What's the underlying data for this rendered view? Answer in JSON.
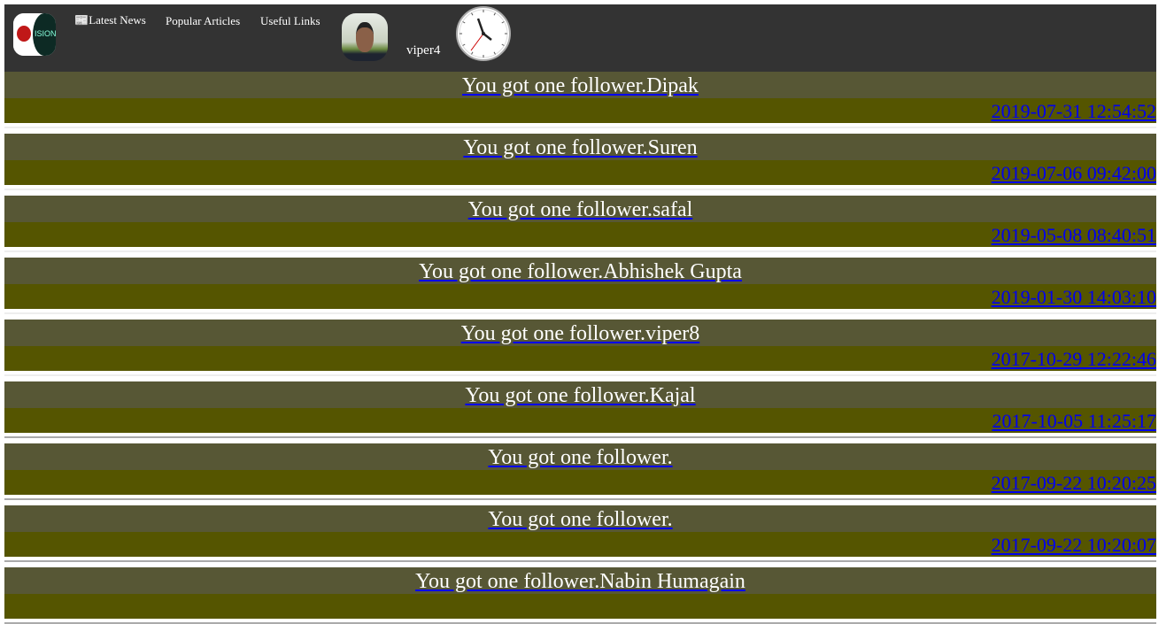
{
  "header": {
    "logo_text": "VISION",
    "nav": [
      {
        "label": "Latest News",
        "icon": "newspaper-icon"
      },
      {
        "label": "Popular Articles"
      },
      {
        "label": "Useful Links"
      }
    ],
    "username": "viper4",
    "clock": {
      "hour": 1,
      "minute": 54
    }
  },
  "notifications": [
    {
      "text": "You got one follower.Dipak",
      "date": "2019-07-31 12:54:52"
    },
    {
      "text": "You got one follower.Suren",
      "date": "2019-07-06 09:42:00"
    },
    {
      "text": "You got one follower.safal",
      "date": "2019-05-08 08:40:51"
    },
    {
      "text": "You got one follower.Abhishek Gupta",
      "date": "2019-01-30 14:03:10"
    },
    {
      "text": "You got one follower.viper8",
      "date": "2017-10-29 12:22:46"
    },
    {
      "text": "You got one follower.Kajal",
      "date": "2017-10-05 11:25:17"
    },
    {
      "text": "You got one follower.",
      "date": "2017-09-22 10:20:25"
    },
    {
      "text": "You got one follower.",
      "date": "2017-09-22 10:20:07"
    },
    {
      "text": "You got one follower.Nabin Humagain",
      "date": ""
    }
  ]
}
